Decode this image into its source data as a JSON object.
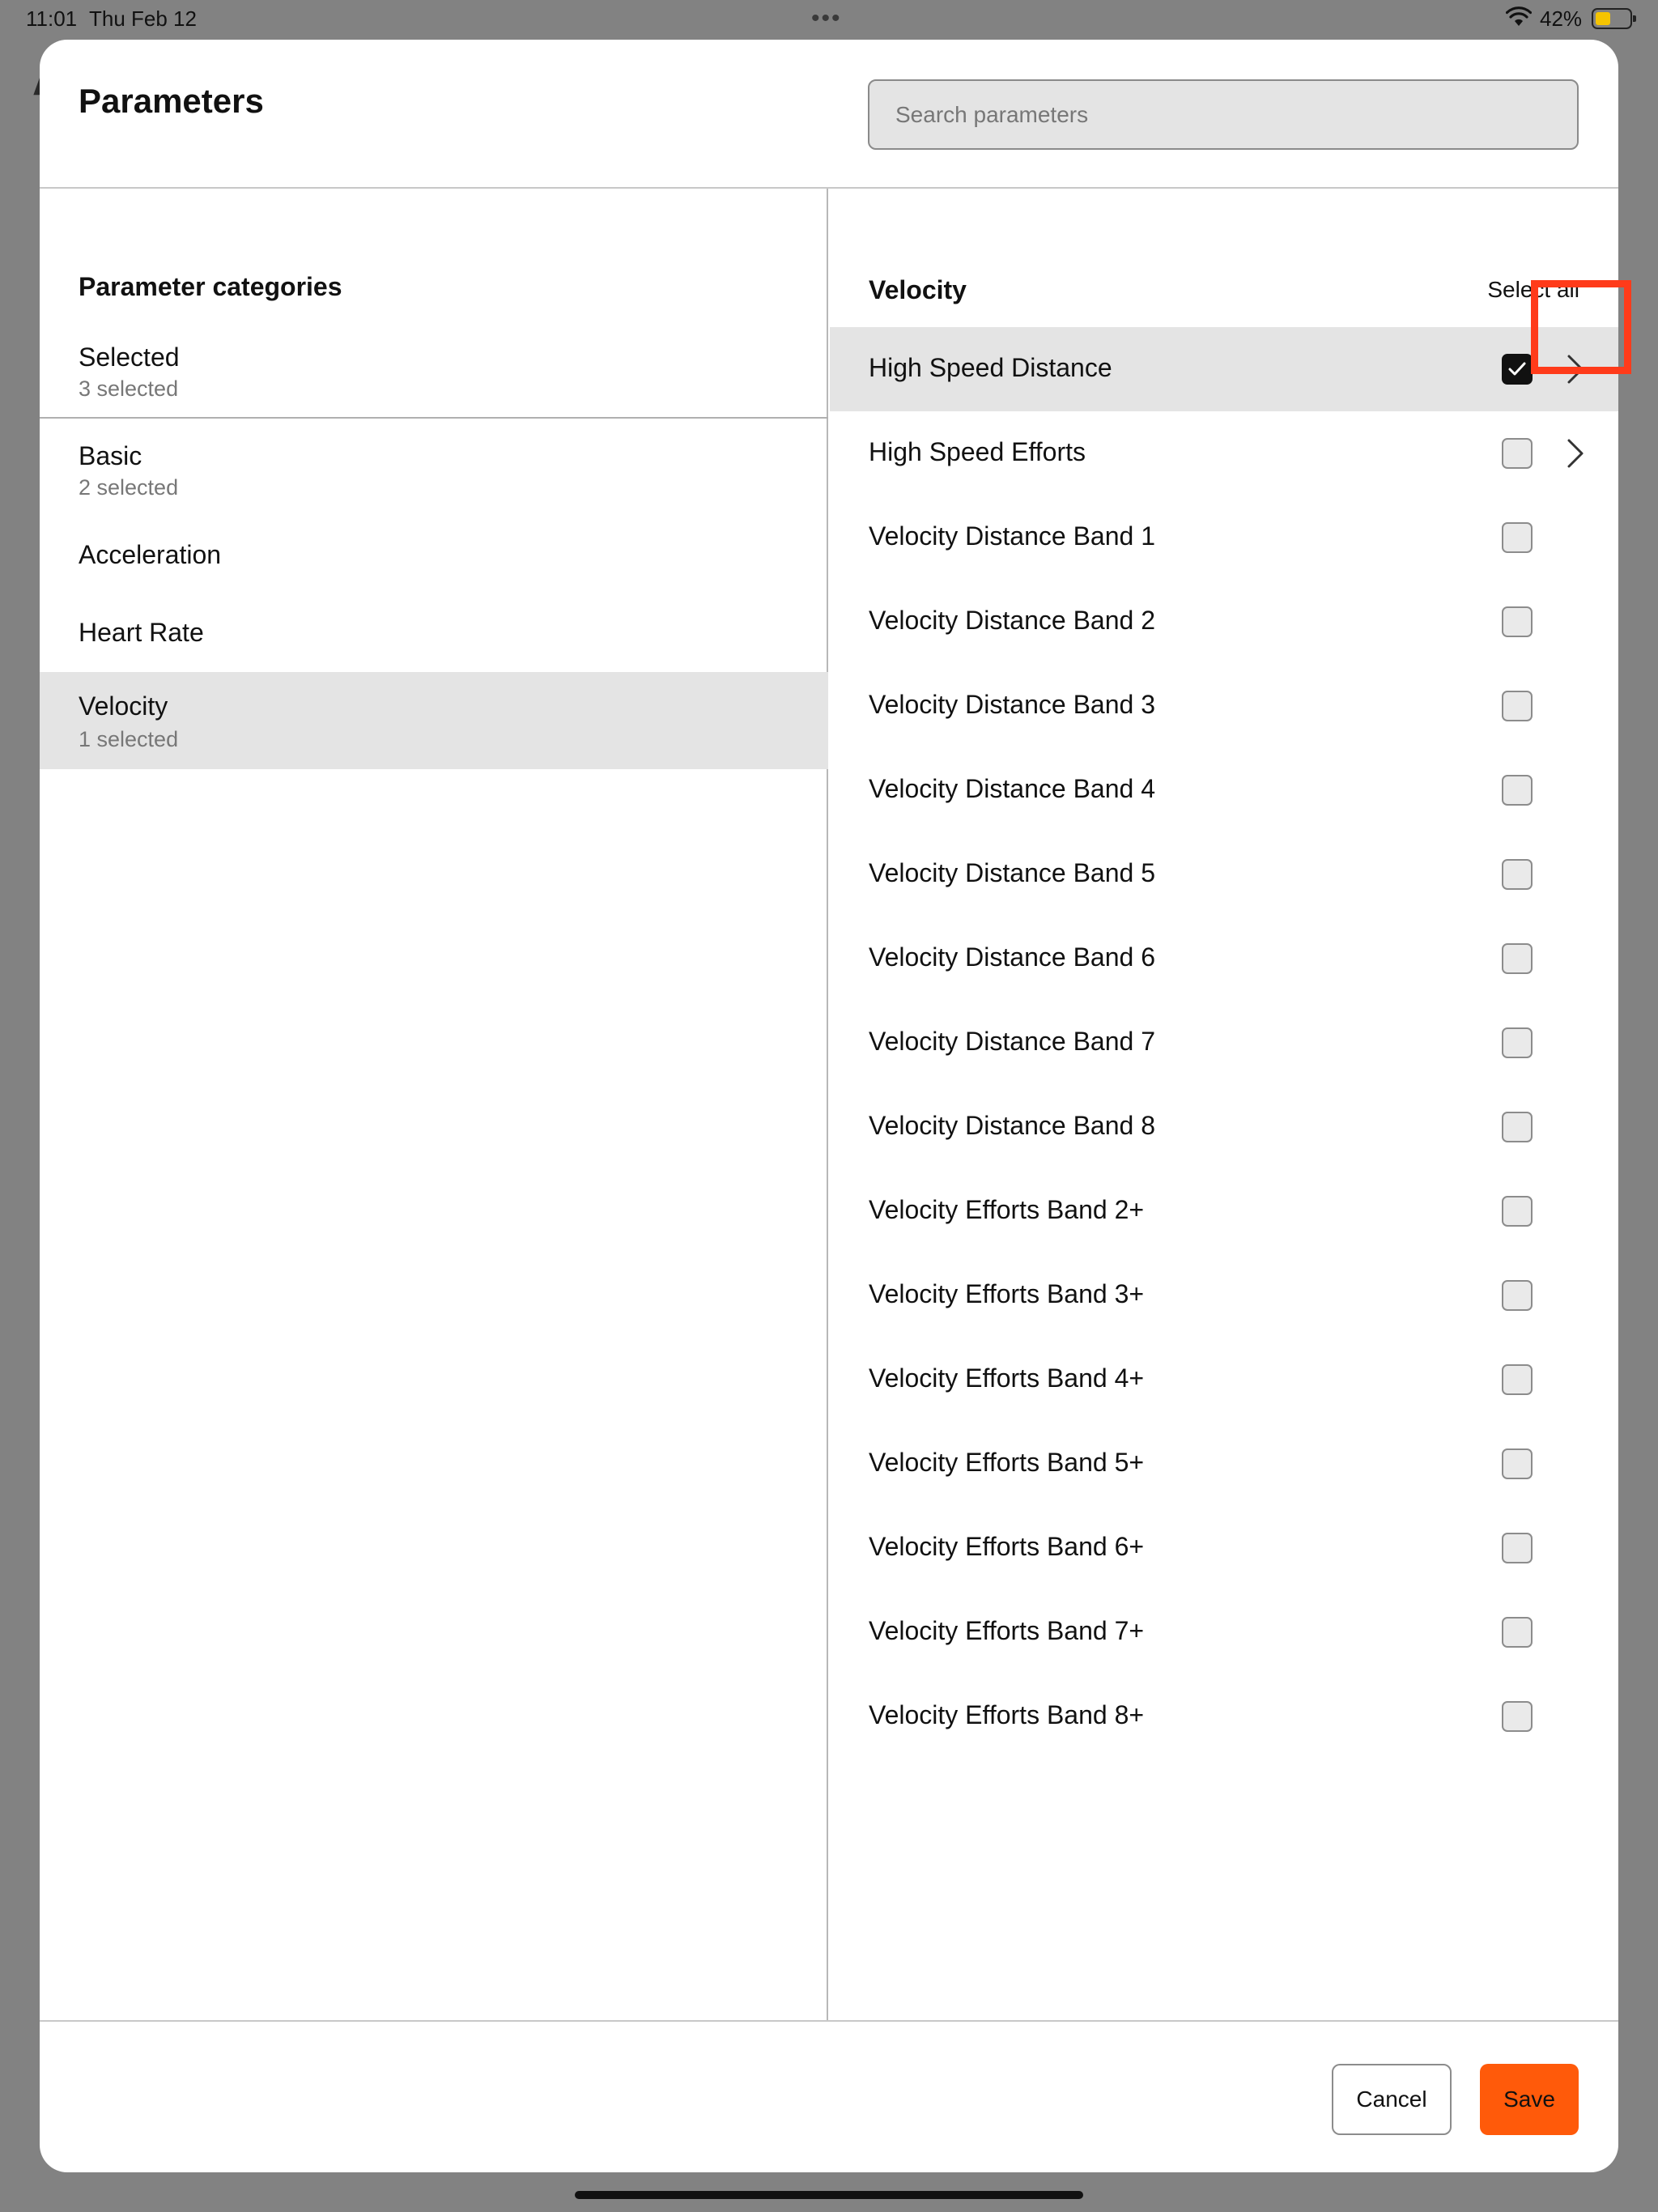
{
  "status": {
    "time": "11:01",
    "date": "Thu Feb 12",
    "battery_pct": "42%",
    "battery_level": 0.42,
    "dots": "•••"
  },
  "background": {
    "letter": "A"
  },
  "modal": {
    "title": "Parameters",
    "search_placeholder": "Search parameters"
  },
  "categories": {
    "heading": "Parameter categories",
    "items": [
      {
        "name": "Selected",
        "sub": "3 selected",
        "active": false
      },
      {
        "name": "Basic",
        "sub": "2 selected",
        "active": false
      },
      {
        "name": "Acceleration",
        "sub": "",
        "active": false
      },
      {
        "name": "Heart Rate",
        "sub": "",
        "active": false
      },
      {
        "name": "Velocity",
        "sub": "1 selected",
        "active": true
      }
    ]
  },
  "parameters": {
    "heading": "Velocity",
    "select_all": "Select all",
    "items": [
      {
        "label": "High Speed Distance",
        "checked": true,
        "has_chevron": true
      },
      {
        "label": "High Speed Efforts",
        "checked": false,
        "has_chevron": true
      },
      {
        "label": "Velocity Distance Band 1",
        "checked": false,
        "has_chevron": false
      },
      {
        "label": "Velocity Distance Band 2",
        "checked": false,
        "has_chevron": false
      },
      {
        "label": "Velocity Distance Band 3",
        "checked": false,
        "has_chevron": false
      },
      {
        "label": "Velocity Distance Band 4",
        "checked": false,
        "has_chevron": false
      },
      {
        "label": "Velocity Distance Band 5",
        "checked": false,
        "has_chevron": false
      },
      {
        "label": "Velocity Distance Band 6",
        "checked": false,
        "has_chevron": false
      },
      {
        "label": "Velocity Distance Band 7",
        "checked": false,
        "has_chevron": false
      },
      {
        "label": "Velocity Distance Band 8",
        "checked": false,
        "has_chevron": false
      },
      {
        "label": "Velocity Efforts Band 2+",
        "checked": false,
        "has_chevron": false
      },
      {
        "label": "Velocity Efforts Band 3+",
        "checked": false,
        "has_chevron": false
      },
      {
        "label": "Velocity Efforts Band 4+",
        "checked": false,
        "has_chevron": false
      },
      {
        "label": "Velocity Efforts Band 5+",
        "checked": false,
        "has_chevron": false
      },
      {
        "label": "Velocity Efforts Band 6+",
        "checked": false,
        "has_chevron": false
      },
      {
        "label": "Velocity Efforts Band 7+",
        "checked": false,
        "has_chevron": false
      },
      {
        "label": "Velocity Efforts Band 8+",
        "checked": false,
        "has_chevron": false
      }
    ]
  },
  "footer": {
    "cancel_label": "Cancel",
    "save_label": "Save"
  },
  "colors": {
    "accent": "#ff5a0a",
    "highlight_box": "#ff3b1a",
    "selected_row_bg": "#e4e4e4"
  }
}
